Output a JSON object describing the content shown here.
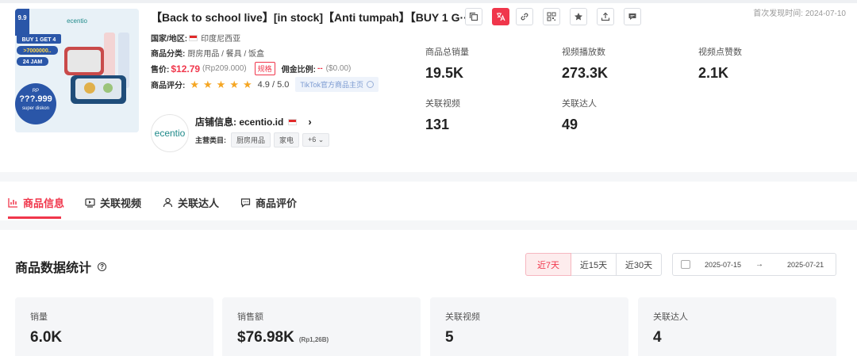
{
  "product": {
    "title": "【Back to school live】[in stock]【Anti tumpah】【BUY 1 G···",
    "first_found_label": "首次发现时间: 2024-07-10",
    "region_label": "国家/地区:",
    "region": "印度尼西亚",
    "category_label": "商品分类:",
    "category": "厨房用品 / 餐具 / 饭盒",
    "price_label": "售价:",
    "price": "$12.79",
    "price_local": "(Rp209.000)",
    "spec_label": "规格",
    "commission_label": "佣金比例:",
    "commission": "--",
    "commission_value": "($0.00)",
    "rating_label": "商品评分:",
    "rating": "4.9 / 5.0",
    "rating_stars": 5,
    "tiktok_link": "TikTok官方商品主页",
    "thumb": {
      "promo": "9.9",
      "brand": "ecentio",
      "buy": "BUY 1 GET 4",
      "sold": ">7000000..",
      "hours": "24 JAM",
      "rp": "RP",
      "price": "???.999",
      "discount": "super diskon"
    }
  },
  "shop": {
    "logo_text": "ecentio",
    "info_label": "店铺信息: ecentio.id",
    "main_cat_label": "主营类目:",
    "tags": [
      "厨房用品",
      "家电"
    ],
    "more": "+6"
  },
  "stats": {
    "total_sales": {
      "label": "商品总销量",
      "value": "19.5K"
    },
    "video_plays": {
      "label": "视频播放数",
      "value": "273.3K"
    },
    "video_likes": {
      "label": "视频点赞数",
      "value": "2.1K"
    },
    "related_videos": {
      "label": "关联视频",
      "value": "131"
    },
    "related_creators": {
      "label": "关联达人",
      "value": "49"
    }
  },
  "tabs": [
    {
      "label": "商品信息",
      "icon": "bar-chart-icon"
    },
    {
      "label": "关联视频",
      "icon": "video-icon"
    },
    {
      "label": "关联达人",
      "icon": "person-icon"
    },
    {
      "label": "商品评价",
      "icon": "comment-icon"
    }
  ],
  "section": {
    "title": "商品数据统计",
    "ranges": [
      "近7天",
      "近15天",
      "近30天"
    ],
    "selected_range": "近7天",
    "date_from": "2025-07-15",
    "date_arrow": "→",
    "date_to": "2025-07-21"
  },
  "cards": [
    {
      "label": "销量",
      "value": "6.0K",
      "sub": ""
    },
    {
      "label": "销售额",
      "value": "$76.98K",
      "sub": "(Rp1,26B)"
    },
    {
      "label": "关联视频",
      "value": "5",
      "sub": ""
    },
    {
      "label": "关联达人",
      "value": "4",
      "sub": ""
    }
  ],
  "colors": {
    "accent": "#f0364b",
    "star": "#f5a623"
  }
}
